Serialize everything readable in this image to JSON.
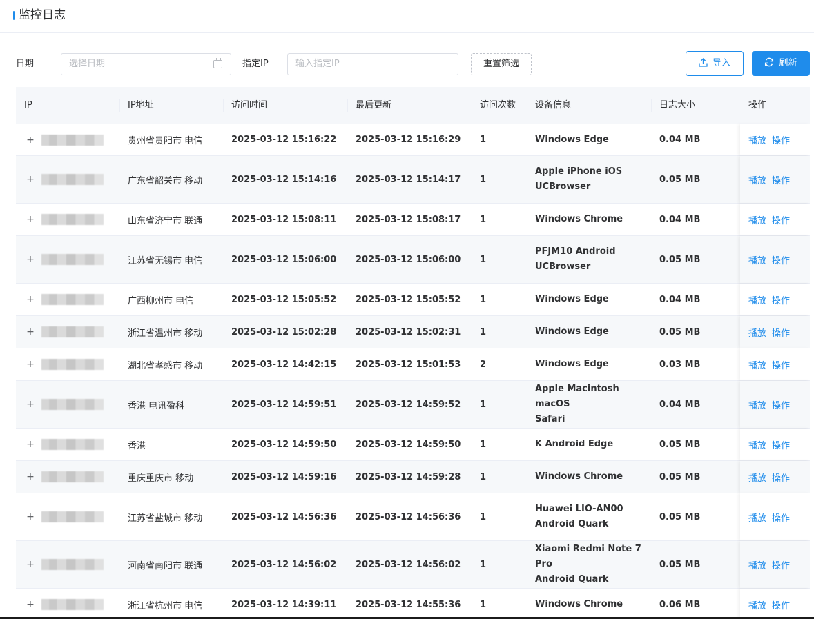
{
  "header": {
    "title": "监控日志"
  },
  "filters": {
    "date_label": "日期",
    "date_placeholder": "选择日期",
    "ip_label": "指定IP",
    "ip_placeholder": "输入指定IP",
    "reset_label": "重置筛选",
    "import_label": "导入",
    "refresh_label": "刷新"
  },
  "colors": {
    "accent": "#1f8ceb",
    "header_bg": "#f5f7fa",
    "row_alt_bg": "#f6f8fa"
  },
  "table": {
    "columns": [
      "IP",
      "IP地址",
      "访问时间",
      "最后更新",
      "访问次数",
      "设备信息",
      "日志大小",
      "操作"
    ],
    "action_play": "播放",
    "action_operate": "操作",
    "rows": [
      {
        "location": "贵州省贵阳市 电信",
        "visit_time": "2025-03-12 15:16:22",
        "last_update": "2025-03-12 15:16:29",
        "count": "1",
        "device": [
          "Windows Edge"
        ],
        "size": "0.04 MB"
      },
      {
        "location": "广东省韶关市 移动",
        "visit_time": "2025-03-12 15:14:16",
        "last_update": "2025-03-12 15:14:17",
        "count": "1",
        "device": [
          "Apple iPhone iOS",
          "UCBrowser"
        ],
        "size": "0.05 MB"
      },
      {
        "location": "山东省济宁市 联通",
        "visit_time": "2025-03-12 15:08:11",
        "last_update": "2025-03-12 15:08:17",
        "count": "1",
        "device": [
          "Windows Chrome"
        ],
        "size": "0.04 MB"
      },
      {
        "location": "江苏省无锡市 电信",
        "visit_time": "2025-03-12 15:06:00",
        "last_update": "2025-03-12 15:06:00",
        "count": "1",
        "device": [
          "PFJM10 Android",
          "UCBrowser"
        ],
        "size": "0.05 MB"
      },
      {
        "location": "广西柳州市 电信",
        "visit_time": "2025-03-12 15:05:52",
        "last_update": "2025-03-12 15:05:52",
        "count": "1",
        "device": [
          "Windows Edge"
        ],
        "size": "0.04 MB"
      },
      {
        "location": "浙江省温州市 移动",
        "visit_time": "2025-03-12 15:02:28",
        "last_update": "2025-03-12 15:02:31",
        "count": "1",
        "device": [
          "Windows Edge"
        ],
        "size": "0.05 MB"
      },
      {
        "location": "湖北省孝感市 移动",
        "visit_time": "2025-03-12 14:42:15",
        "last_update": "2025-03-12 15:01:53",
        "count": "2",
        "device": [
          "Windows Edge"
        ],
        "size": "0.03 MB"
      },
      {
        "location": "香港 电讯盈科",
        "visit_time": "2025-03-12 14:59:51",
        "last_update": "2025-03-12 14:59:52",
        "count": "1",
        "device": [
          "Apple Macintosh macOS",
          "Safari"
        ],
        "size": "0.04 MB"
      },
      {
        "location": "香港",
        "visit_time": "2025-03-12 14:59:50",
        "last_update": "2025-03-12 14:59:50",
        "count": "1",
        "device": [
          "K Android Edge"
        ],
        "size": "0.05 MB"
      },
      {
        "location": "重庆重庆市 移动",
        "visit_time": "2025-03-12 14:59:16",
        "last_update": "2025-03-12 14:59:28",
        "count": "1",
        "device": [
          "Windows Chrome"
        ],
        "size": "0.05 MB"
      },
      {
        "location": "江苏省盐城市 移动",
        "visit_time": "2025-03-12 14:56:36",
        "last_update": "2025-03-12 14:56:36",
        "count": "1",
        "device": [
          "Huawei LIO-AN00",
          "Android Quark"
        ],
        "size": "0.05 MB"
      },
      {
        "location": "河南省南阳市 联通",
        "visit_time": "2025-03-12 14:56:02",
        "last_update": "2025-03-12 14:56:02",
        "count": "1",
        "device": [
          "Xiaomi Redmi Note 7 Pro",
          "Android Quark"
        ],
        "size": "0.05 MB"
      },
      {
        "location": "浙江省杭州市 电信",
        "visit_time": "2025-03-12 14:39:11",
        "last_update": "2025-03-12 14:55:36",
        "count": "1",
        "device": [
          "Windows Chrome"
        ],
        "size": "0.06 MB"
      }
    ]
  }
}
